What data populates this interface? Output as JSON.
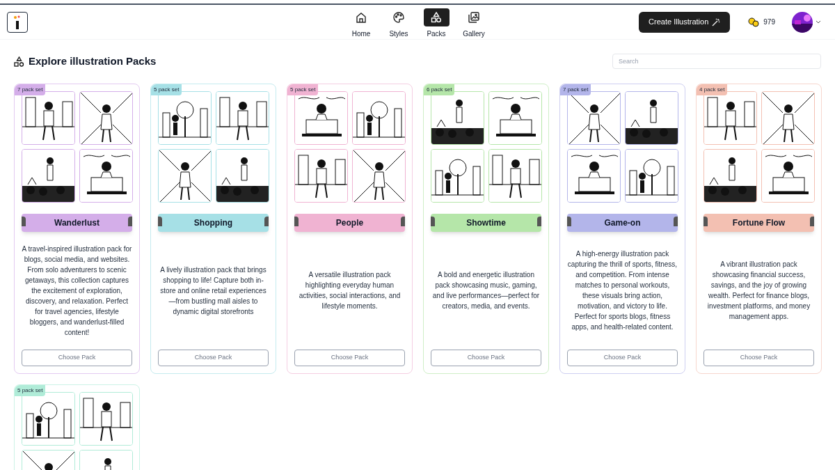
{
  "header": {
    "nav": [
      {
        "label": "Home",
        "selected": false
      },
      {
        "label": "Styles",
        "selected": false
      },
      {
        "label": "Packs",
        "selected": true
      },
      {
        "label": "Gallery",
        "selected": false
      }
    ],
    "create_button": "Create Illustration",
    "coins": "979"
  },
  "page": {
    "title": "Explore illustration Packs",
    "search": {
      "placeholder": "Search"
    }
  },
  "packs": [
    {
      "badge": "7 pack set",
      "color": "#d4aee9",
      "title": "Wanderlust",
      "description": "A travel-inspired illustration pack for blogs, social media, and websites. From solo adventurers to scenic getaways, this collection captures the excitement of exploration, discovery, and relaxation. Perfect for travel agencies, lifestyle bloggers, and wanderlust-filled content!",
      "button": "Choose Pack"
    },
    {
      "badge": "5 pack set",
      "color": "#a6e0e6",
      "title": "Shopping",
      "description": "A lively illustration pack that brings shopping to life! Capture both in-store and online retail experiences—from bustling mall aisles to dynamic digital storefronts",
      "button": "Choose Pack"
    },
    {
      "badge": "5 pack set",
      "color": "#f0b3d2",
      "title": "People",
      "description": "A versatile illustration pack highlighting everyday human activities, social interactions, and lifestyle moments.",
      "button": "Choose Pack"
    },
    {
      "badge": "6 pack set",
      "color": "#b5e6a9",
      "title": "Showtime",
      "description": "A bold and energetic illustration pack showcasing music, gaming, and live performances—perfect for creators, media, and events.",
      "button": "Choose Pack"
    },
    {
      "badge": "7 pack set",
      "color": "#b3b5ea",
      "title": "Game-on",
      "description": "A high-energy illustration pack capturing the thrill of sports, fitness, and competition. From intense matches to personal workouts, these visuals bring action, motivation, and victory to life. Perfect for sports blogs, fitness apps, and health-related content.",
      "button": "Choose Pack"
    },
    {
      "badge": "4 pack set",
      "color": "#f3c0b2",
      "title": "Fortune Flow",
      "description": "A vibrant illustration pack showcasing financial success, savings, and the joy of growing wealth. Perfect for finance blogs, investment platforms, and money management apps.",
      "button": "Choose Pack"
    },
    {
      "badge": "5 pack set",
      "color": "#b0ecd8"
    }
  ]
}
